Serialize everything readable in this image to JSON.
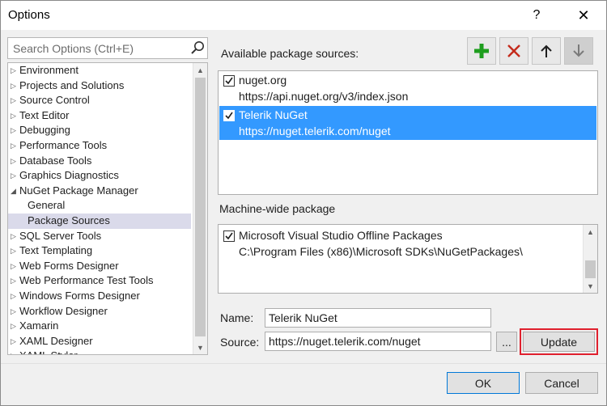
{
  "window": {
    "title": "Options",
    "help_glyph": "?",
    "close_glyph": "✕"
  },
  "search": {
    "placeholder": "Search Options (Ctrl+E)"
  },
  "tree": {
    "items": [
      {
        "label": "Environment",
        "state": "collapsed",
        "level": 0
      },
      {
        "label": "Projects and Solutions",
        "state": "collapsed",
        "level": 0
      },
      {
        "label": "Source Control",
        "state": "collapsed",
        "level": 0
      },
      {
        "label": "Text Editor",
        "state": "collapsed",
        "level": 0
      },
      {
        "label": "Debugging",
        "state": "collapsed",
        "level": 0
      },
      {
        "label": "Performance Tools",
        "state": "collapsed",
        "level": 0
      },
      {
        "label": "Database Tools",
        "state": "collapsed",
        "level": 0
      },
      {
        "label": "Graphics Diagnostics",
        "state": "collapsed",
        "level": 0
      },
      {
        "label": "NuGet Package Manager",
        "state": "expanded",
        "level": 0
      },
      {
        "label": "General",
        "state": "leaf",
        "level": 1
      },
      {
        "label": "Package Sources",
        "state": "leaf",
        "level": 1,
        "selected": true
      },
      {
        "label": "SQL Server Tools",
        "state": "collapsed",
        "level": 0
      },
      {
        "label": "Text Templating",
        "state": "collapsed",
        "level": 0
      },
      {
        "label": "Web Forms Designer",
        "state": "collapsed",
        "level": 0
      },
      {
        "label": "Web Performance Test Tools",
        "state": "collapsed",
        "level": 0
      },
      {
        "label": "Windows Forms Designer",
        "state": "collapsed",
        "level": 0
      },
      {
        "label": "Workflow Designer",
        "state": "collapsed",
        "level": 0
      },
      {
        "label": "Xamarin",
        "state": "collapsed",
        "level": 0
      },
      {
        "label": "XAML Designer",
        "state": "collapsed",
        "level": 0
      },
      {
        "label": "XAML Styler",
        "state": "collapsed",
        "level": 0
      }
    ]
  },
  "available": {
    "label": "Available package sources:",
    "sources": [
      {
        "name": "nuget.org",
        "url": "https://api.nuget.org/v3/index.json",
        "checked": true,
        "selected": false
      },
      {
        "name": "Telerik NuGet",
        "url": "https://nuget.telerik.com/nuget",
        "checked": true,
        "selected": true
      }
    ]
  },
  "toolbar": {
    "add_icon": "plus-icon",
    "remove_icon": "x-icon",
    "up_icon": "arrow-up-icon",
    "down_icon": "arrow-down-icon",
    "add_color": "#1e9e1e",
    "remove_color": "#c42b1c"
  },
  "machine": {
    "label": "Machine-wide package",
    "sources": [
      {
        "name": "Microsoft Visual Studio Offline Packages",
        "url": "C:\\Program Files (x86)\\Microsoft SDKs\\NuGetPackages\\",
        "checked": true
      }
    ]
  },
  "form": {
    "name_label": "Name:",
    "name_value": "Telerik NuGet",
    "source_label": "Source:",
    "source_value": "https://nuget.telerik.com/nuget",
    "browse_label": "...",
    "update_label": "Update"
  },
  "footer": {
    "ok_label": "OK",
    "cancel_label": "Cancel"
  },
  "colors": {
    "selection": "#3399ff",
    "tree_selection": "#dadaea",
    "highlight_border": "#e0202e"
  }
}
